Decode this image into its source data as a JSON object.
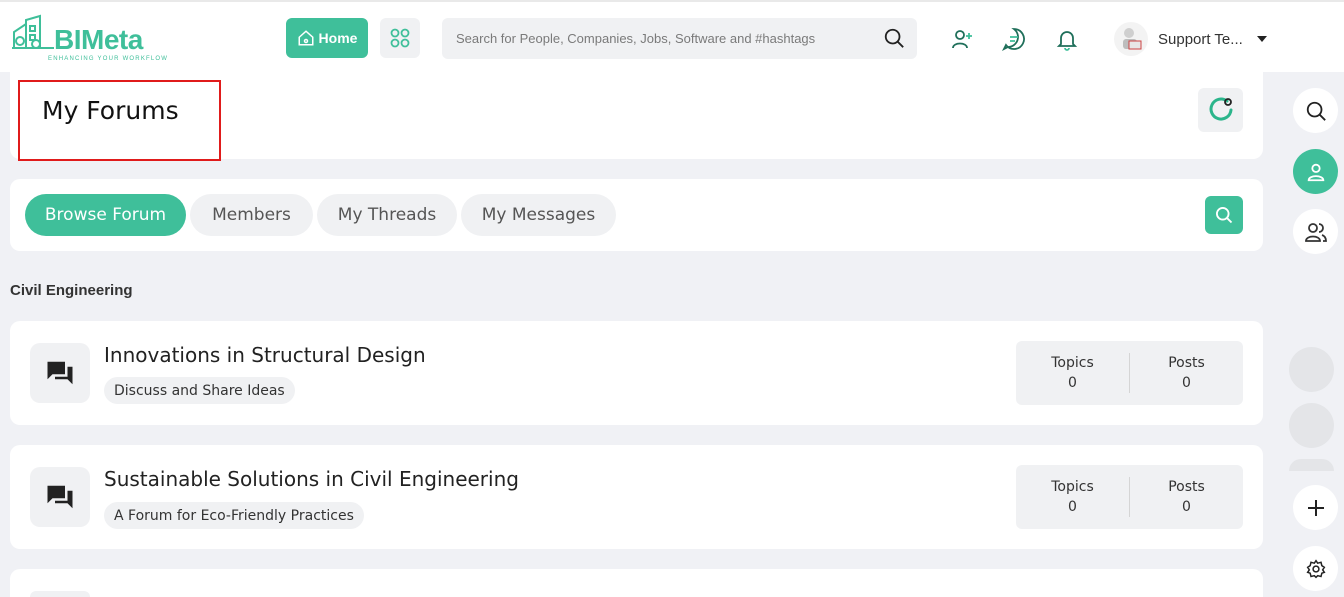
{
  "brand": {
    "name": "BIMeta",
    "tagline": "ENHANCING YOUR WORKFLOW",
    "accent": "#3fbf9a"
  },
  "header": {
    "home_label": "Home",
    "search_placeholder": "Search for People, Companies, Jobs, Software and #hashtags",
    "user_name": "Support Te...",
    "icons": [
      "home-icon",
      "apps-grid-icon",
      "search-icon",
      "add-user-icon",
      "chat-icon",
      "bell-icon",
      "caret-down-icon"
    ]
  },
  "page": {
    "title": "My Forums",
    "highlight_color": "#e01b1b"
  },
  "tabs": [
    {
      "label": "Browse Forum",
      "active": true
    },
    {
      "label": "Members",
      "active": false
    },
    {
      "label": "My Threads",
      "active": false
    },
    {
      "label": "My Messages",
      "active": false
    }
  ],
  "section": {
    "label": "Civil Engineering"
  },
  "forums": [
    {
      "title": "Innovations in Structural Design",
      "tag": "Discuss and Share Ideas",
      "topics_label": "Topics",
      "topics": "0",
      "posts_label": "Posts",
      "posts": "0"
    },
    {
      "title": "Sustainable Solutions in Civil Engineering",
      "tag": "A Forum for Eco-Friendly Practices",
      "topics_label": "Topics",
      "topics": "0",
      "posts_label": "Posts",
      "posts": "0"
    }
  ],
  "right_rail": {
    "icons": [
      "search-icon",
      "user-icon",
      "users-icon",
      "plus-icon",
      "settings-icon"
    ]
  }
}
